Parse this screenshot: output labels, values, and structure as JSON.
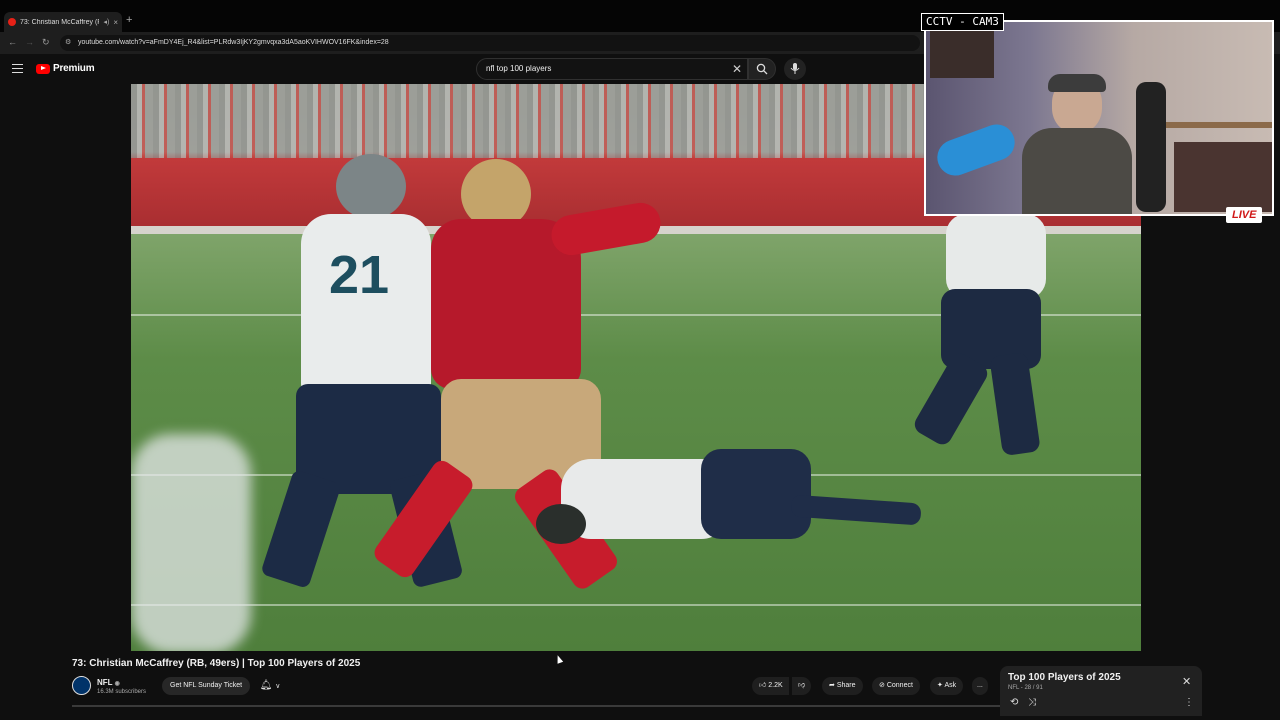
{
  "browser": {
    "tab_title": "73: Christian McCaffrey (RB...",
    "tab_close": "×",
    "new_tab": "+",
    "url": "youtube.com/watch?v=aFmDY4Ej_R4&list=PLRdw3IjKY2gmvqxa3dA5aoKVIHWOV16FK&index=28"
  },
  "header": {
    "brand": "Premium",
    "search_query": "nfl top 100 players"
  },
  "webcam": {
    "label": "CCTV - CAM3",
    "live_badge": "LIVE"
  },
  "video": {
    "title": "73: Christian McCaffrey (RB, 49ers) | Top 100 Players of 2025",
    "jersey_number": "21"
  },
  "channel": {
    "name": "NFL",
    "subscribers": "16.3M subscribers",
    "promo_button": "Get NFL Sunday Ticket"
  },
  "actions": {
    "like_count": "2.2K",
    "share": "Share",
    "connect": "Connect",
    "ask": "Ask",
    "more": "..."
  },
  "playlist": {
    "title": "Top 100 Players of 2025",
    "subtitle": "NFL - 28 / 91"
  },
  "colors": {
    "yt_red": "#ff0000",
    "niners_red": "#aa0000",
    "seahawks_navy": "#002244"
  }
}
